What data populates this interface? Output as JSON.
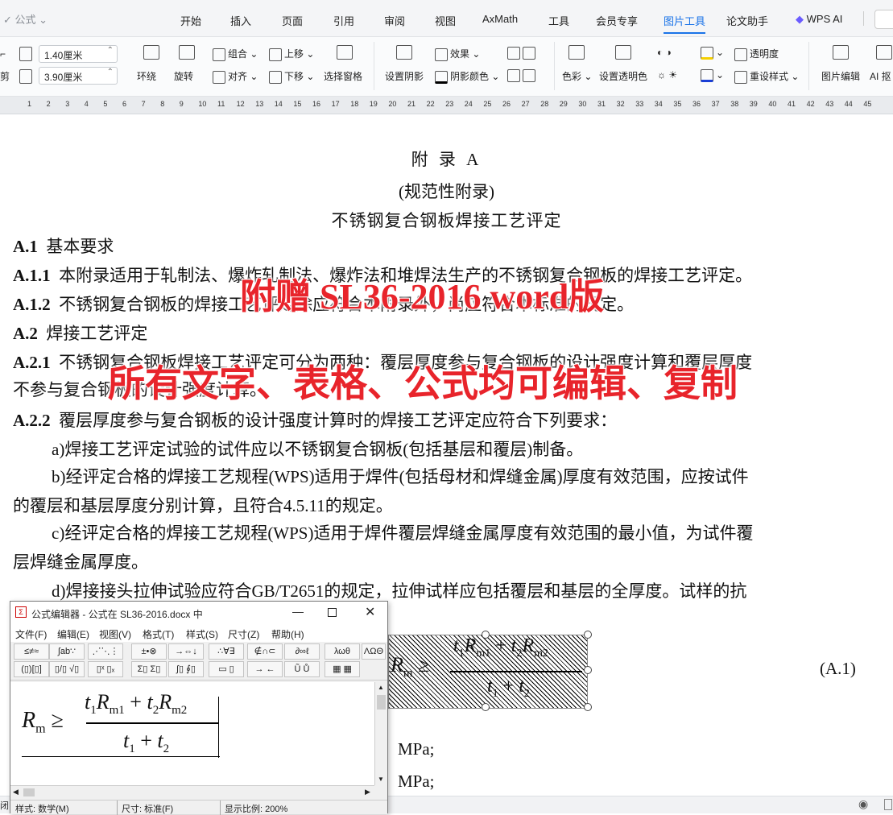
{
  "quick_access": {
    "formula_label": "公式",
    "dropdown_glyph": "⌄"
  },
  "tabs": [
    {
      "label": "开始",
      "active": false
    },
    {
      "label": "插入",
      "active": false
    },
    {
      "label": "页面",
      "active": false
    },
    {
      "label": "引用",
      "active": false
    },
    {
      "label": "审阅",
      "active": false
    },
    {
      "label": "视图",
      "active": false
    },
    {
      "label": "AxMath",
      "active": false
    },
    {
      "label": "工具",
      "active": false
    },
    {
      "label": "会员专享",
      "active": false
    },
    {
      "label": "图片工具",
      "active": true
    },
    {
      "label": "论文助手",
      "active": false
    },
    {
      "label": "WPS AI",
      "active": false
    }
  ],
  "toolbar": {
    "crop_label": "剪",
    "width_value": "1.40厘米",
    "height_value": "3.90厘米",
    "wrap": "环绕",
    "rotate": "旋转",
    "group": "组合",
    "align": "对齐",
    "bring_forward": "上移",
    "send_backward": "下移",
    "selection_pane": "选择窗格",
    "set_shadow": "设置阴影",
    "effect": "效果",
    "shadow_color": "阴影颜色",
    "color": "色彩",
    "set_transparent": "设置透明色",
    "transparency": "透明度",
    "reset_style": "重设样式",
    "image_edit": "图片编辑",
    "ai_cutout": "AI 抠"
  },
  "ruler": {
    "ticks": [
      "1",
      "2",
      "3",
      "4",
      "5",
      "6",
      "7",
      "8",
      "9",
      "10",
      "11",
      "12",
      "13",
      "14",
      "15",
      "16",
      "17",
      "18",
      "19",
      "20",
      "21",
      "22",
      "23",
      "24",
      "25",
      "26",
      "27",
      "28",
      "29",
      "30",
      "31",
      "32",
      "33",
      "34",
      "35",
      "36",
      "37",
      "38",
      "39",
      "40",
      "41",
      "42",
      "43",
      "44",
      "45"
    ]
  },
  "document": {
    "heading1": "附 录 A",
    "heading2": "(规范性附录)",
    "heading3": "不锈钢复合钢板焊接工艺评定",
    "a1_num": "A.1",
    "a1_title": "基本要求",
    "a11_num": "A.1.1",
    "a11_text": "本附录适用于轧制法、爆炸轧制法、爆炸法和堆焊法生产的不锈钢复合钢板的焊接工艺评定。",
    "a12_num": "A.1.2",
    "a12_text": "不锈钢复合钢板的焊接工艺评定除应符合本附录外，尚应符合本标准的规定。",
    "a2_num": "A.2",
    "a2_title": "焊接工艺评定",
    "a21_num": "A.2.1",
    "a21_text1": "不锈钢复合钢板焊接工艺评定可分为两种：覆层厚度参与复合钢板的设计强度计算和覆层厚度",
    "a21_text2": "不参与复合钢板的设计强度计算。",
    "a22_num": "A.2.2",
    "a22_text": "覆层厚度参与复合钢板的设计强度计算时的焊接工艺评定应符合下列要求：",
    "item_a": "a)焊接工艺评定试验的试件应以不锈钢复合钢板(包括基层和覆层)制备。",
    "item_b1": "b)经评定合格的焊接工艺规程(WPS)适用于焊件(包括母材和焊缝金属)厚度有效范围，应按试件",
    "item_b2": "的覆层和基层厚度分别计算，且符合4.5.11的规定。",
    "item_c1": "c)经评定合格的焊接工艺规程(WPS)适用于焊件覆层焊缝金属厚度有效范围的最小值，为试件覆",
    "item_c2": "层焊缝金属厚度。",
    "item_d1": "d)焊接接头拉伸试验应符合GB/T2651的规定，拉伸试样应包括覆层和基层的全厚度。试样的抗",
    "eq_number": "(A.1)",
    "unit1": "MPa;",
    "unit2": "MPa;"
  },
  "watermark": {
    "line1": "附赠 SL36-2016 word版",
    "line2": "所有文字、表格、公式均可编辑、复制"
  },
  "formula": {
    "R": "R",
    "m": "m",
    "geq": "≥",
    "t": "t",
    "one": "1",
    "two": "2",
    "m1": "m1",
    "m2": "m2",
    "plus": "+"
  },
  "equation_editor": {
    "title": "公式编辑器 - 公式在 SL36-2016.docx 中",
    "menu": [
      "文件(F)",
      "编辑(E)",
      "视图(V)",
      "格式(T)",
      "样式(S)",
      "尺寸(Z)",
      "帮助(H)"
    ],
    "palette_row1": [
      "≤≠≈",
      "∫ab∵",
      "⋰⋱⋮",
      "±•⊗",
      "→⇔↓",
      "∴∀∃",
      "∉∩⊂",
      "∂∞ℓ",
      "λωθ",
      "ΛΩΘ"
    ],
    "palette_row2": [
      "(▯)[▯]",
      "▯/▯ √▯",
      "▯ˣ ▯ₓ",
      "Σ▯ Σ▯",
      "∫▯ ∮▯",
      "▭ ▯",
      "→ ←",
      "Ũ Ů",
      "▦ ▦"
    ],
    "status_style": "样式: 数学(M)",
    "status_size": "尺寸: 标准(F)",
    "status_zoom": "显示比例: 200%"
  },
  "statusbar": {
    "left": "闭"
  }
}
